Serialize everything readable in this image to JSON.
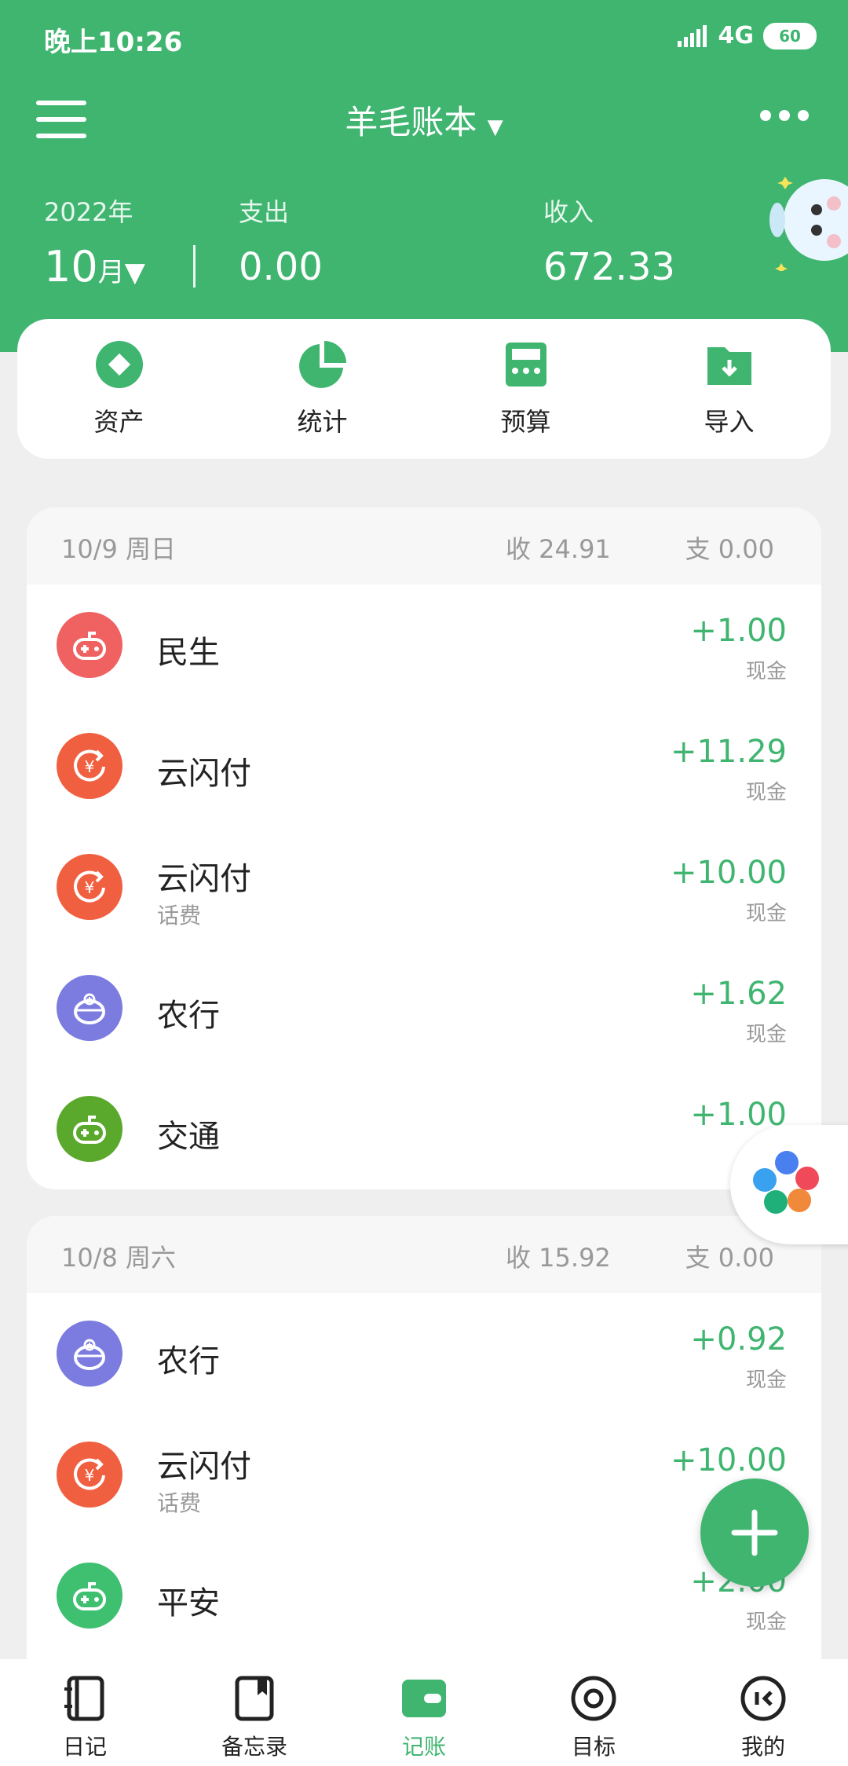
{
  "status_bar": {
    "time": "晚上10:26",
    "network": "4G",
    "battery": "60"
  },
  "header": {
    "book_title": "羊毛账本",
    "year": "2022年",
    "month": "10",
    "month_unit": "月",
    "expense_label": "支出",
    "expense_value": "0.00",
    "income_label": "收入",
    "income_value": "672.33"
  },
  "quick_actions": [
    {
      "label": "资产",
      "icon": "diamond-icon"
    },
    {
      "label": "统计",
      "icon": "pie-chart-icon"
    },
    {
      "label": "预算",
      "icon": "calculator-icon"
    },
    {
      "label": "导入",
      "icon": "import-folder-icon"
    }
  ],
  "days": [
    {
      "date": "10/9 周日",
      "income": "收 24.91",
      "expense": "支 0.00",
      "items": [
        {
          "name": "民生",
          "sub": "",
          "amount": "+1.00",
          "account": "现金",
          "icon_color": "#f06262",
          "icon": "gamepad-icon"
        },
        {
          "name": "云闪付",
          "sub": "",
          "amount": "+11.29",
          "account": "现金",
          "icon_color": "#f06040",
          "icon": "yen-refund-icon"
        },
        {
          "name": "云闪付",
          "sub": "话费",
          "amount": "+10.00",
          "account": "现金",
          "icon_color": "#f06040",
          "icon": "yen-refund-icon"
        },
        {
          "name": "农行",
          "sub": "",
          "amount": "+1.62",
          "account": "现金",
          "icon_color": "#7b7be0",
          "icon": "piggy-bank-icon"
        },
        {
          "name": "交通",
          "sub": "",
          "amount": "+1.00",
          "account": "",
          "icon_color": "#5aa82c",
          "icon": "gamepad-icon"
        }
      ]
    },
    {
      "date": "10/8 周六",
      "income": "收 15.92",
      "expense": "支 0.00",
      "items": [
        {
          "name": "农行",
          "sub": "",
          "amount": "+0.92",
          "account": "现金",
          "icon_color": "#7b7be0",
          "icon": "piggy-bank-icon"
        },
        {
          "name": "云闪付",
          "sub": "话费",
          "amount": "+10.00",
          "account": "",
          "icon_color": "#f06040",
          "icon": "yen-refund-icon"
        },
        {
          "name": "平安",
          "sub": "",
          "amount": "+2.00",
          "account": "现金",
          "icon_color": "#3fc070",
          "icon": "gamepad-icon"
        }
      ]
    }
  ],
  "bottom_nav": [
    {
      "label": "日记",
      "icon": "diary-icon",
      "active": false
    },
    {
      "label": "备忘录",
      "icon": "memo-icon",
      "active": false
    },
    {
      "label": "记账",
      "icon": "wallet-icon",
      "active": true
    },
    {
      "label": "目标",
      "icon": "target-icon",
      "active": false
    },
    {
      "label": "我的",
      "icon": "profile-face-icon",
      "active": false
    }
  ],
  "colors": {
    "primary": "#3fb570",
    "background": "#efefef"
  }
}
